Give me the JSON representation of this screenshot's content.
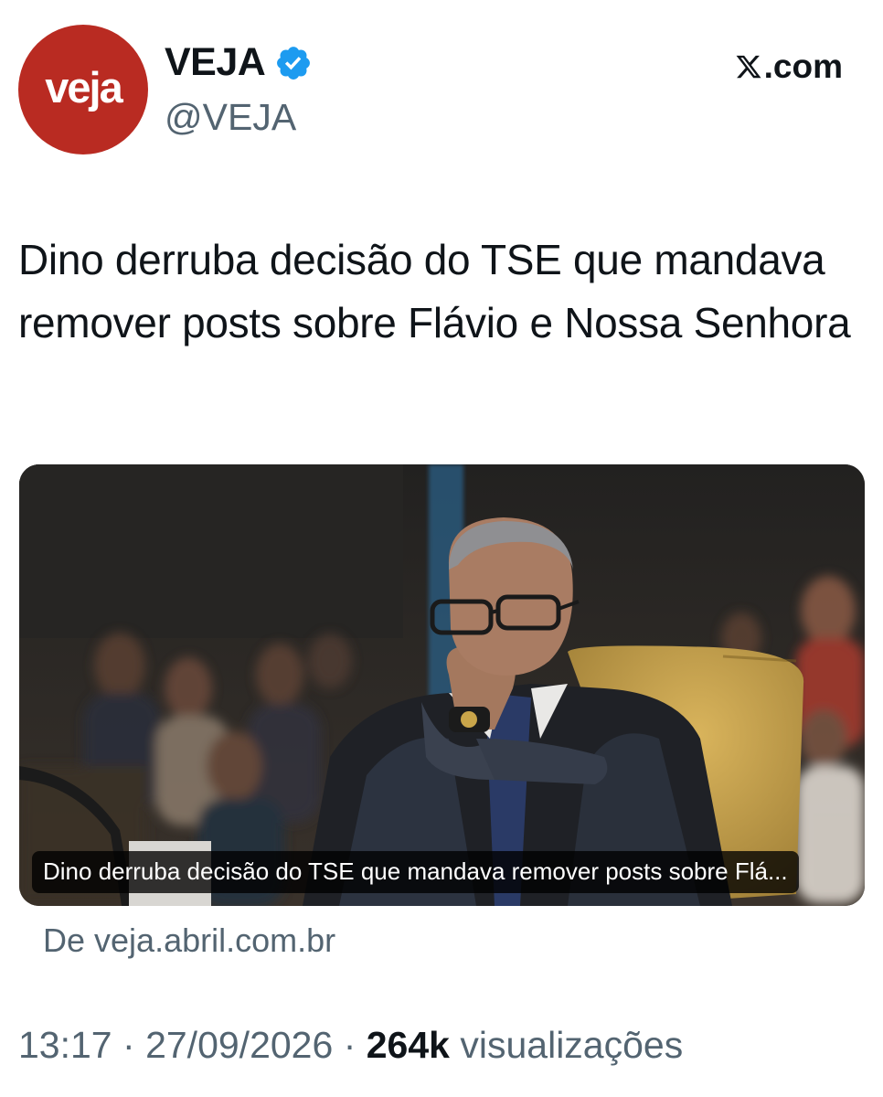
{
  "header": {
    "avatar_text": "veja",
    "display_name": "VEJA",
    "handle": "@VEJA",
    "site_label": ".com"
  },
  "post": {
    "text": "Dino derruba decisão do TSE que mandava remover posts sobre Flávio e Nossa Senhora"
  },
  "card": {
    "caption": "Dino derruba decisão do TSE que mandava remover posts sobre Flá...",
    "source": "De veja.abril.com.br"
  },
  "meta": {
    "time": "13:17",
    "separator": "·",
    "date": "27/09/2026",
    "views_count": "264k",
    "views_label": "visualizações"
  },
  "colors": {
    "avatar_bg": "#b92b22",
    "verified": "#1d9bf0",
    "secondary_text": "#536471",
    "primary_text": "#0f1419"
  },
  "icons": {
    "verified": "verified-badge-icon",
    "x_logo": "x-logo-icon"
  }
}
